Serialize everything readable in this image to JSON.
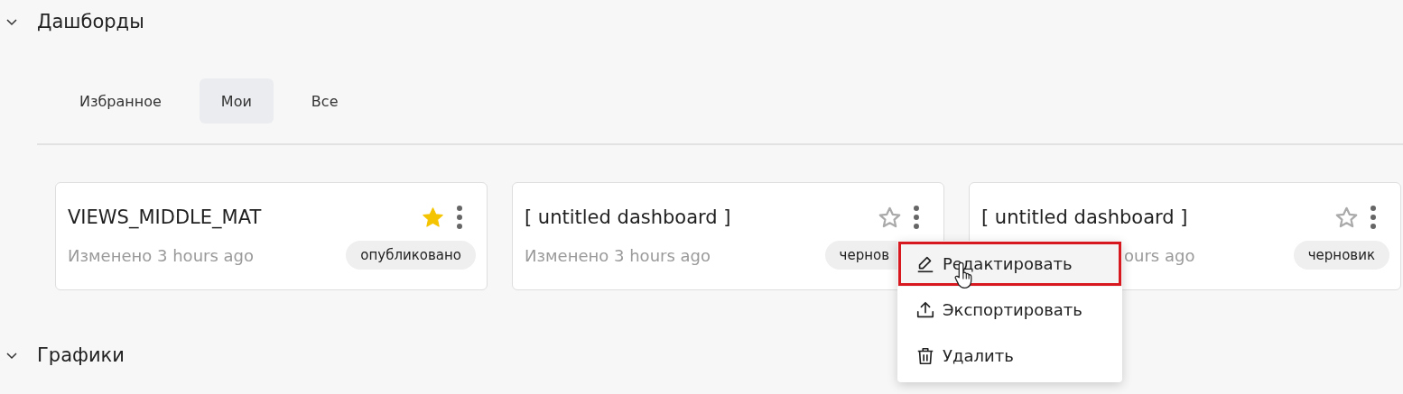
{
  "sections": [
    {
      "title": "Дашборды",
      "expanded": true,
      "tabs": [
        {
          "label": "Избранное",
          "selected": false
        },
        {
          "label": "Мои",
          "selected": true
        },
        {
          "label": "Все",
          "selected": false
        }
      ],
      "cards": [
        {
          "title": "VIEWS_MIDDLE_MAT",
          "favorite": true,
          "subtitle": "Изменено 3 hours ago",
          "badge": "опубликовано"
        },
        {
          "title": "[ untitled dashboard ]",
          "favorite": false,
          "subtitle": "Изменено 3 hours ago",
          "badge": "чернов",
          "menu": {
            "items": [
              {
                "kind": "edit",
                "label": "Редактировать",
                "highlighted": true
              },
              {
                "kind": "export",
                "label": "Экспортировать",
                "highlighted": false
              },
              {
                "kind": "delete",
                "label": "Удалить",
                "highlighted": false
              }
            ]
          }
        },
        {
          "title": "[ untitled dashboard ]",
          "favorite": false,
          "subtitle": "ours ago",
          "badge": "черновик"
        }
      ]
    },
    {
      "title": "Графики",
      "expanded": true
    }
  ]
}
